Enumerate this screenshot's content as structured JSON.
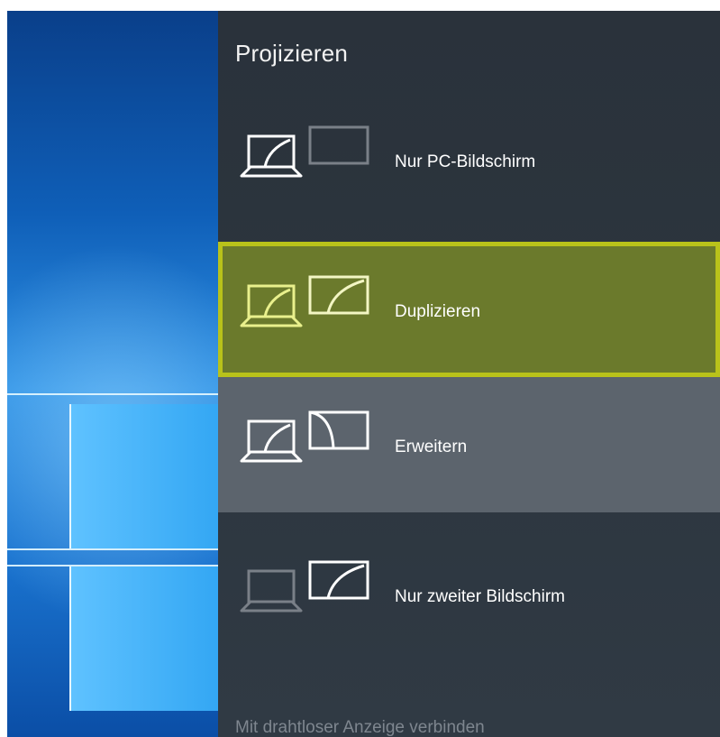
{
  "flyout": {
    "title": "Projizieren",
    "options": [
      {
        "label": "Nur PC-Bildschirm",
        "icon": "pc-screen-only-icon",
        "selected": false
      },
      {
        "label": "Duplizieren",
        "icon": "duplicate-icon",
        "selected": true
      },
      {
        "label": "Erweitern",
        "icon": "extend-icon",
        "selected": false
      },
      {
        "label": "Nur zweiter Bildschirm",
        "icon": "second-screen-only-icon",
        "selected": false
      }
    ],
    "footer_link": "Mit drahtloser Anzeige verbinden"
  },
  "colors": {
    "flyout_background": "#2c353e",
    "selected_background": "#6b7a2c",
    "selected_border": "#b9c21a",
    "hover_background": "#5c646d",
    "selected_icon": "#e9f08c",
    "dimmed_icon": "#7a8088"
  }
}
